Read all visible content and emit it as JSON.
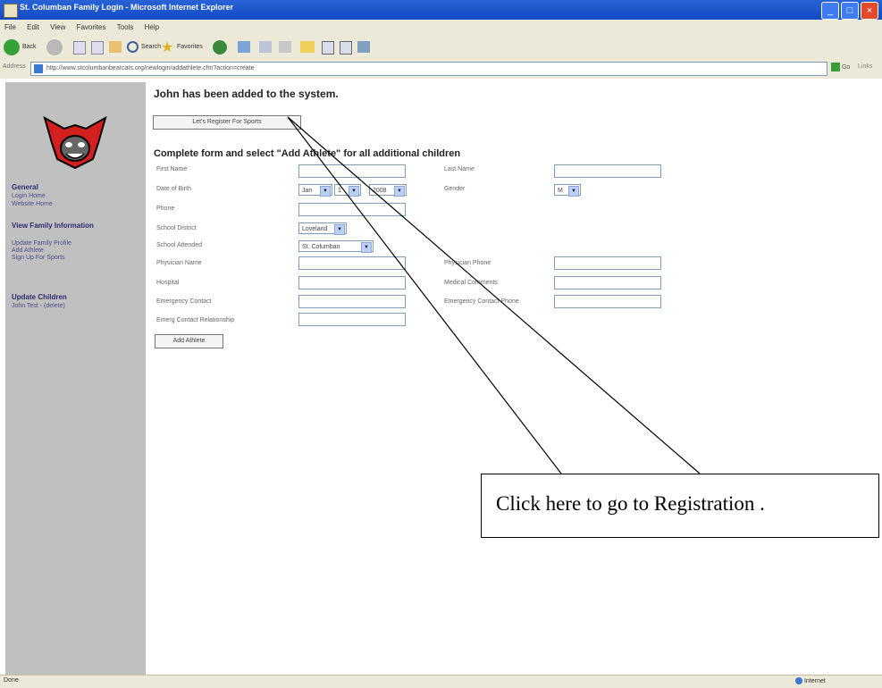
{
  "window": {
    "title": "St. Columban Family Login - Microsoft Internet Explorer"
  },
  "menu": [
    "File",
    "Edit",
    "View",
    "Favorites",
    "Tools",
    "Help"
  ],
  "toolbar": {
    "back": "Back",
    "search": "Search",
    "favorites": "Favorites"
  },
  "address": {
    "label": "Address",
    "url": "http://www.stcolumbanbearcats.org/newlogin/addathlete.cfm?action=create",
    "go_label": "Go",
    "links_label": "Links"
  },
  "sidebar": {
    "general": {
      "title": "General",
      "links": [
        "Login Home",
        "Website Home"
      ]
    },
    "family": {
      "title": "View Family Information",
      "links": [
        "Update Family Profile",
        "Add Athlete",
        "Sign Up For Sports"
      ]
    },
    "children": {
      "title": "Update Children",
      "links": [
        "John Test - (delete)"
      ]
    }
  },
  "main": {
    "message": "John has been added to the system.",
    "register_button": "Let's Register For Sports",
    "form_heading": "Complete form and select \"Add Athlete\" for all additional children",
    "labels": {
      "first_name": "First Name",
      "last_name": "Last Name",
      "dob": "Date of Birth",
      "gender": "Gender",
      "phone": "Phone",
      "school_district": "School District",
      "school_attended": "School Attended",
      "physician_name": "Physician Name",
      "physician_phone": "Physician Phone",
      "hospital": "Hospital",
      "medical_comments": "Medical Comments",
      "emergency_contact": "Emergency Contact",
      "emergency_contact_phone": "Emergency Contact Phone",
      "emergency_relationship": "Emerg Contact Relationship"
    },
    "values": {
      "dob_month": "Jan",
      "dob_day": "1",
      "dob_year": "2008",
      "gender": "M",
      "school_district": "Loveland",
      "school_attended": "St. Columban"
    },
    "add_athlete_button": "Add Athlete"
  },
  "callout": {
    "text": "Click here to go to Registration ."
  },
  "status": {
    "left": "Done",
    "zone": "Internet"
  }
}
